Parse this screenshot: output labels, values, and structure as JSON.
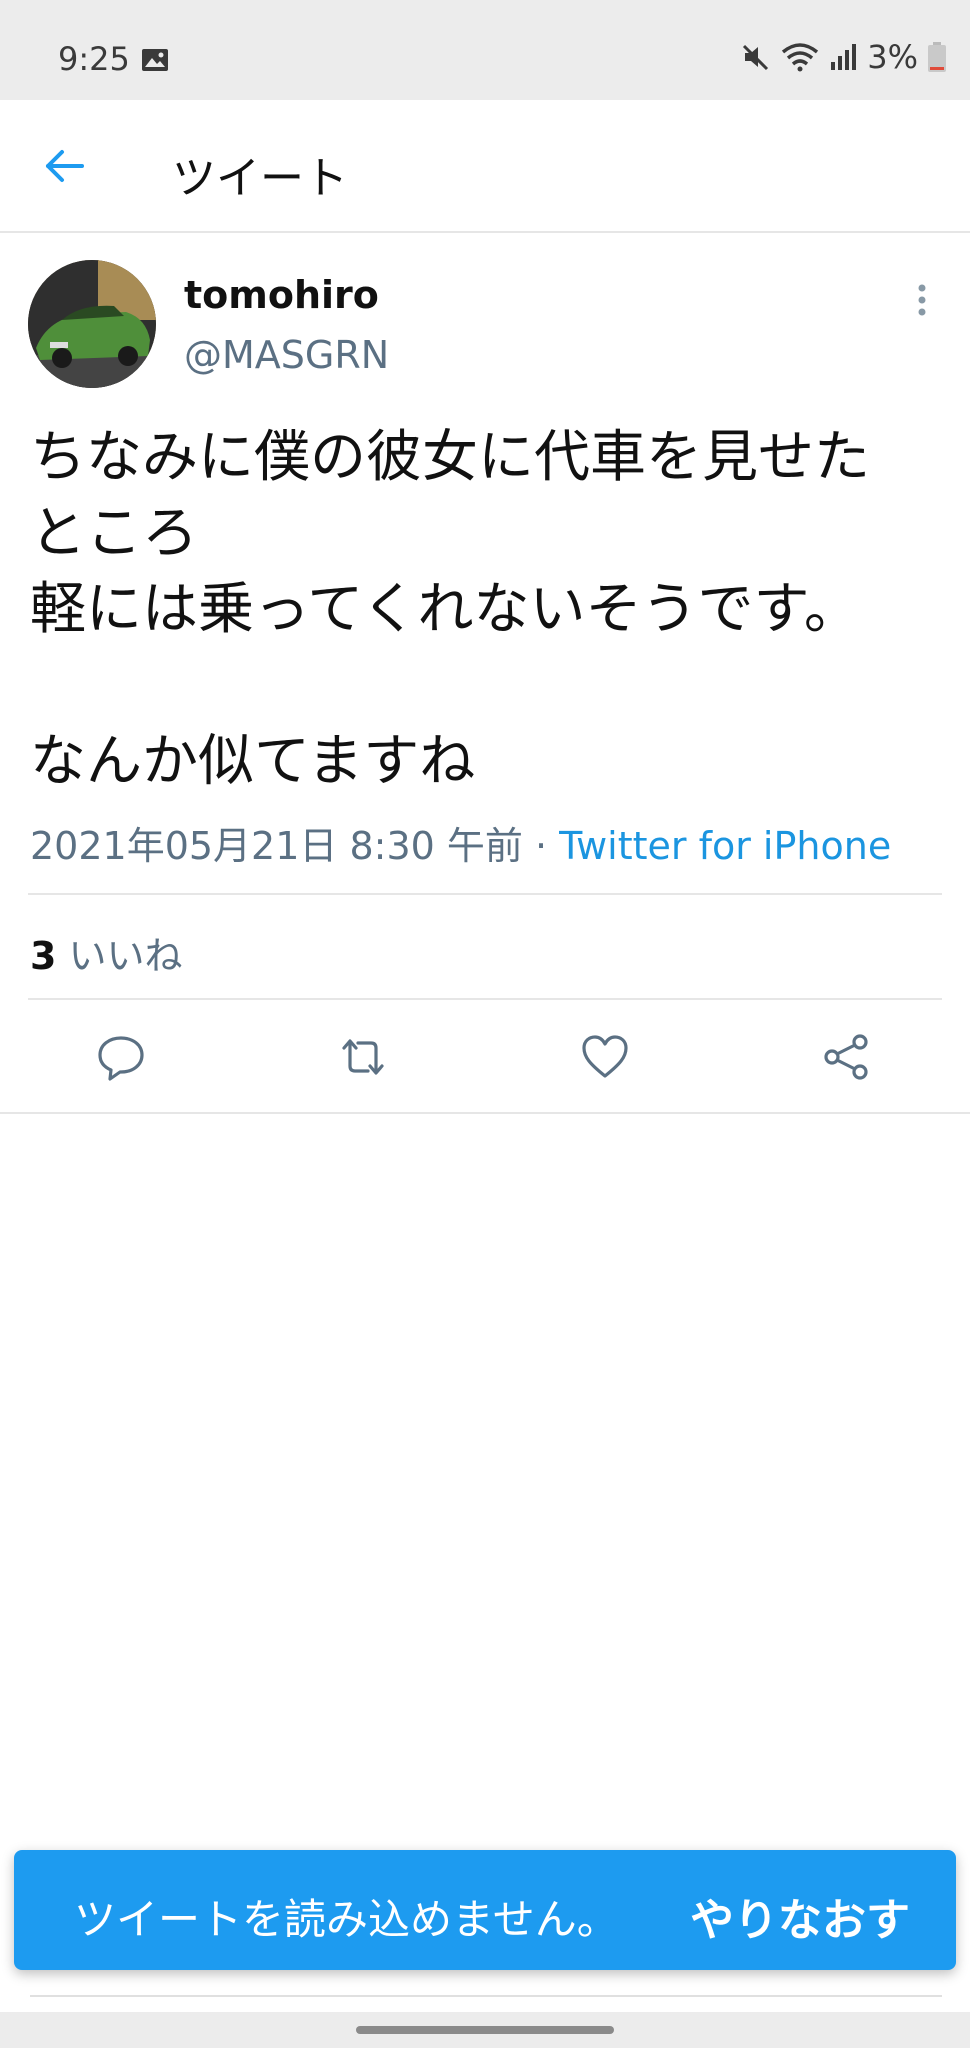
{
  "status_bar": {
    "time": "9:25",
    "battery_percent": "3%"
  },
  "app_bar": {
    "title": "ツイート"
  },
  "tweet": {
    "author_name": "tomohiro",
    "author_handle": "@MASGRN",
    "text": "ちなみに僕の彼女に代車を見せた\nところ\n軽には乗ってくれないそうです。\n\nなんか似てますね",
    "date": "2021年05月21日 8:30 午前",
    "separator": " · ",
    "source": "Twitter for iPhone",
    "like_count": "3",
    "like_label": "いいね"
  },
  "snackbar": {
    "message": "ツイートを読み込めません。",
    "action": "やりなおす",
    "color": "#1d9bf0"
  },
  "icons": [
    "image-icon",
    "mute-icon",
    "wifi-icon",
    "signal-icon",
    "battery-icon",
    "back-arrow-icon",
    "more-vertical-icon",
    "reply-icon",
    "retweet-icon",
    "like-icon",
    "share-icon"
  ]
}
